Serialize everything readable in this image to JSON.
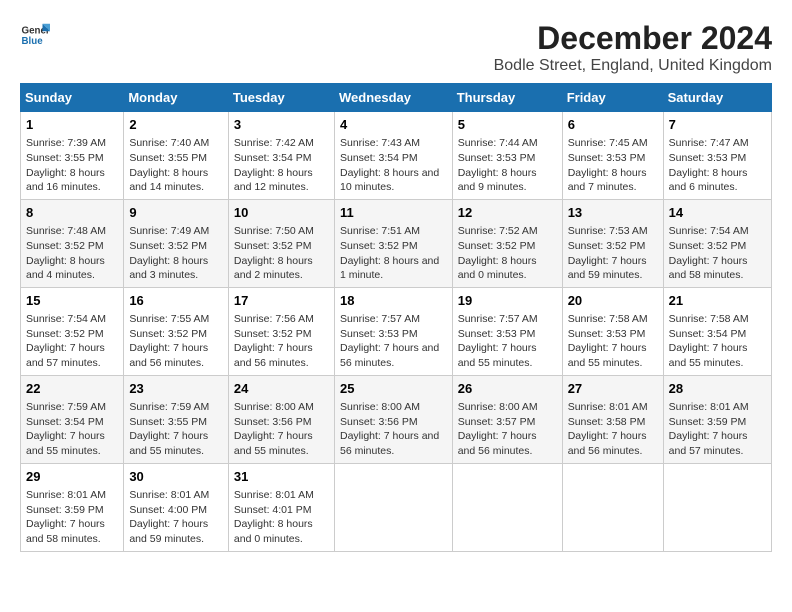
{
  "header": {
    "logo_line1": "General",
    "logo_line2": "Blue",
    "title": "December 2024",
    "subtitle": "Bodle Street, England, United Kingdom"
  },
  "calendar": {
    "columns": [
      "Sunday",
      "Monday",
      "Tuesday",
      "Wednesday",
      "Thursday",
      "Friday",
      "Saturday"
    ],
    "weeks": [
      [
        {
          "day": "1",
          "content": "Sunrise: 7:39 AM\nSunset: 3:55 PM\nDaylight: 8 hours and 16 minutes."
        },
        {
          "day": "2",
          "content": "Sunrise: 7:40 AM\nSunset: 3:55 PM\nDaylight: 8 hours and 14 minutes."
        },
        {
          "day": "3",
          "content": "Sunrise: 7:42 AM\nSunset: 3:54 PM\nDaylight: 8 hours and 12 minutes."
        },
        {
          "day": "4",
          "content": "Sunrise: 7:43 AM\nSunset: 3:54 PM\nDaylight: 8 hours and 10 minutes."
        },
        {
          "day": "5",
          "content": "Sunrise: 7:44 AM\nSunset: 3:53 PM\nDaylight: 8 hours and 9 minutes."
        },
        {
          "day": "6",
          "content": "Sunrise: 7:45 AM\nSunset: 3:53 PM\nDaylight: 8 hours and 7 minutes."
        },
        {
          "day": "7",
          "content": "Sunrise: 7:47 AM\nSunset: 3:53 PM\nDaylight: 8 hours and 6 minutes."
        }
      ],
      [
        {
          "day": "8",
          "content": "Sunrise: 7:48 AM\nSunset: 3:52 PM\nDaylight: 8 hours and 4 minutes."
        },
        {
          "day": "9",
          "content": "Sunrise: 7:49 AM\nSunset: 3:52 PM\nDaylight: 8 hours and 3 minutes."
        },
        {
          "day": "10",
          "content": "Sunrise: 7:50 AM\nSunset: 3:52 PM\nDaylight: 8 hours and 2 minutes."
        },
        {
          "day": "11",
          "content": "Sunrise: 7:51 AM\nSunset: 3:52 PM\nDaylight: 8 hours and 1 minute."
        },
        {
          "day": "12",
          "content": "Sunrise: 7:52 AM\nSunset: 3:52 PM\nDaylight: 8 hours and 0 minutes."
        },
        {
          "day": "13",
          "content": "Sunrise: 7:53 AM\nSunset: 3:52 PM\nDaylight: 7 hours and 59 minutes."
        },
        {
          "day": "14",
          "content": "Sunrise: 7:54 AM\nSunset: 3:52 PM\nDaylight: 7 hours and 58 minutes."
        }
      ],
      [
        {
          "day": "15",
          "content": "Sunrise: 7:54 AM\nSunset: 3:52 PM\nDaylight: 7 hours and 57 minutes."
        },
        {
          "day": "16",
          "content": "Sunrise: 7:55 AM\nSunset: 3:52 PM\nDaylight: 7 hours and 56 minutes."
        },
        {
          "day": "17",
          "content": "Sunrise: 7:56 AM\nSunset: 3:52 PM\nDaylight: 7 hours and 56 minutes."
        },
        {
          "day": "18",
          "content": "Sunrise: 7:57 AM\nSunset: 3:53 PM\nDaylight: 7 hours and 56 minutes."
        },
        {
          "day": "19",
          "content": "Sunrise: 7:57 AM\nSunset: 3:53 PM\nDaylight: 7 hours and 55 minutes."
        },
        {
          "day": "20",
          "content": "Sunrise: 7:58 AM\nSunset: 3:53 PM\nDaylight: 7 hours and 55 minutes."
        },
        {
          "day": "21",
          "content": "Sunrise: 7:58 AM\nSunset: 3:54 PM\nDaylight: 7 hours and 55 minutes."
        }
      ],
      [
        {
          "day": "22",
          "content": "Sunrise: 7:59 AM\nSunset: 3:54 PM\nDaylight: 7 hours and 55 minutes."
        },
        {
          "day": "23",
          "content": "Sunrise: 7:59 AM\nSunset: 3:55 PM\nDaylight: 7 hours and 55 minutes."
        },
        {
          "day": "24",
          "content": "Sunrise: 8:00 AM\nSunset: 3:56 PM\nDaylight: 7 hours and 55 minutes."
        },
        {
          "day": "25",
          "content": "Sunrise: 8:00 AM\nSunset: 3:56 PM\nDaylight: 7 hours and 56 minutes."
        },
        {
          "day": "26",
          "content": "Sunrise: 8:00 AM\nSunset: 3:57 PM\nDaylight: 7 hours and 56 minutes."
        },
        {
          "day": "27",
          "content": "Sunrise: 8:01 AM\nSunset: 3:58 PM\nDaylight: 7 hours and 56 minutes."
        },
        {
          "day": "28",
          "content": "Sunrise: 8:01 AM\nSunset: 3:59 PM\nDaylight: 7 hours and 57 minutes."
        }
      ],
      [
        {
          "day": "29",
          "content": "Sunrise: 8:01 AM\nSunset: 3:59 PM\nDaylight: 7 hours and 58 minutes."
        },
        {
          "day": "30",
          "content": "Sunrise: 8:01 AM\nSunset: 4:00 PM\nDaylight: 7 hours and 59 minutes."
        },
        {
          "day": "31",
          "content": "Sunrise: 8:01 AM\nSunset: 4:01 PM\nDaylight: 8 hours and 0 minutes."
        },
        null,
        null,
        null,
        null
      ]
    ]
  }
}
